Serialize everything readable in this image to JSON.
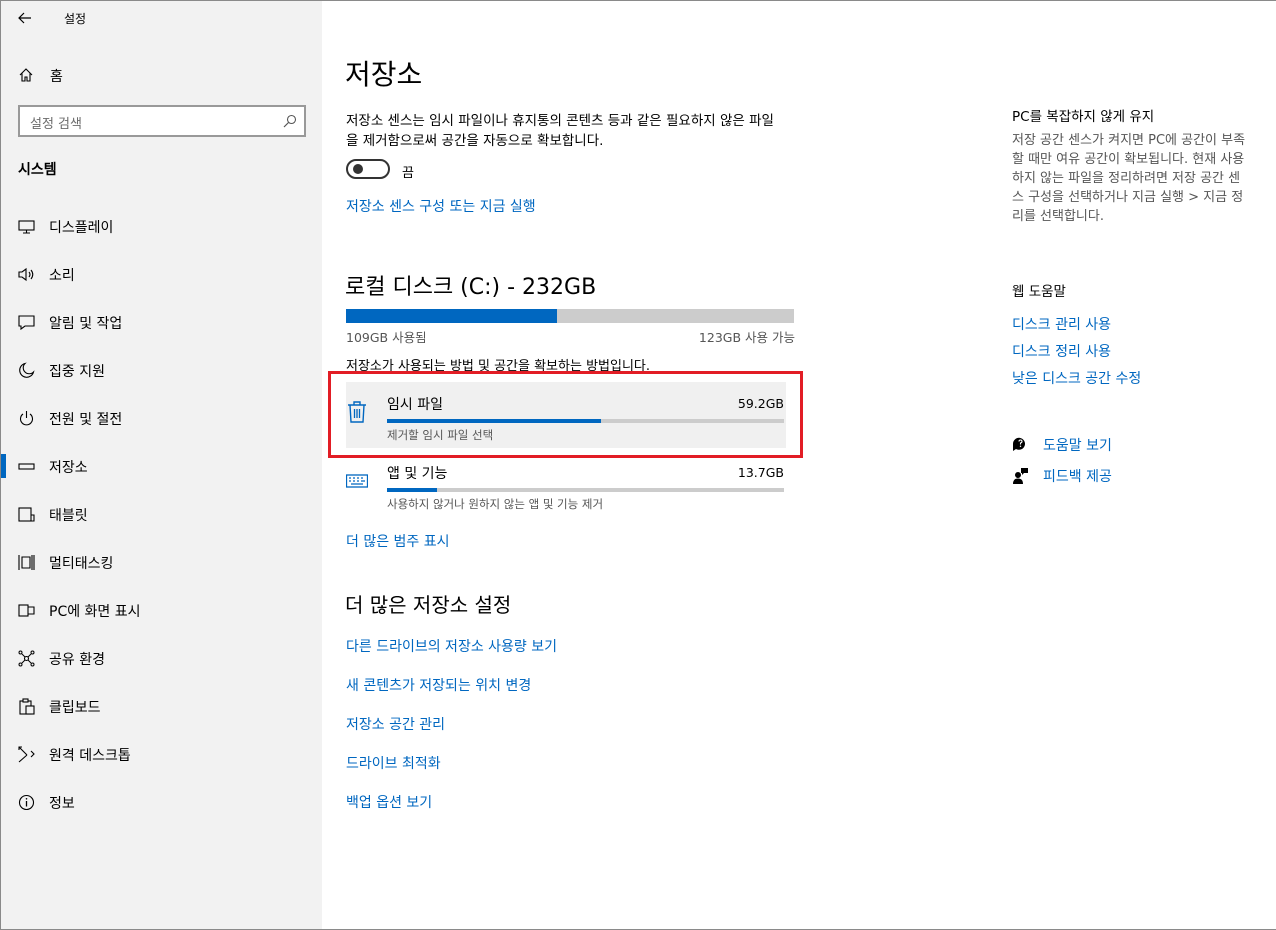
{
  "window": {
    "title": "설정",
    "minimize_glyph": "─",
    "maximize_glyph": "☐",
    "close_glyph": "✕"
  },
  "sidebar": {
    "home_label": "홈",
    "search_placeholder": "설정 검색",
    "section_title": "시스템",
    "items": [
      {
        "label": "디스플레이",
        "icon": "monitor-icon"
      },
      {
        "label": "소리",
        "icon": "speaker-icon"
      },
      {
        "label": "알림 및 작업",
        "icon": "notification-icon"
      },
      {
        "label": "집중 지원",
        "icon": "moon-icon"
      },
      {
        "label": "전원 및 절전",
        "icon": "power-icon"
      },
      {
        "label": "저장소",
        "icon": "storage-icon",
        "active": true
      },
      {
        "label": "태블릿",
        "icon": "tablet-icon"
      },
      {
        "label": "멀티태스킹",
        "icon": "multitasking-icon"
      },
      {
        "label": "PC에 화면 표시",
        "icon": "project-icon"
      },
      {
        "label": "공유 환경",
        "icon": "share-icon"
      },
      {
        "label": "클립보드",
        "icon": "clipboard-icon"
      },
      {
        "label": "원격 데스크톱",
        "icon": "remote-desktop-icon"
      },
      {
        "label": "정보",
        "icon": "info-icon"
      }
    ]
  },
  "main": {
    "title": "저장소",
    "description": "저장소 센스는 임시 파일이나 휴지통의 콘텐츠 등과 같은 필요하지 않은 파일을 제거함으로써 공간을 자동으로 확보합니다.",
    "toggle_state_label": "끔",
    "toggle_on": false,
    "configure_link": "저장소 센스 구성 또는 지금 실행",
    "drive": {
      "title": "로컬 디스크 (C:) - 232GB",
      "used_label": "109GB 사용됨",
      "free_label": "123GB 사용 가능",
      "used_fraction": 0.47
    },
    "hint": "저장소가 사용되는 방법 및 공간을 확보하는 방법입니다.",
    "categories": [
      {
        "name": "임시 파일",
        "size": "59.2GB",
        "sub": "제거할 임시 파일 선택",
        "fraction": 0.54,
        "icon": "trash-icon"
      },
      {
        "name": "앱 및 기능",
        "size": "13.7GB",
        "sub": "사용하지 않거나 원하지 않는 앱 및 기능 제거",
        "fraction": 0.125,
        "icon": "keyboard-icon"
      }
    ],
    "more_categories_link": "더 많은 범주 표시",
    "more_settings_title": "더 많은 저장소 설정",
    "more_links": [
      "다른 드라이브의 저장소 사용량 보기",
      "새 콘텐츠가 저장되는 위치 변경",
      "저장소 공간 관리",
      "드라이브 최적화",
      "백업 옵션 보기"
    ]
  },
  "right": {
    "keep_title": "PC를 복잡하지 않게 유지",
    "keep_text": "저장 공간 센스가 켜지면 PC에 공간이 부족할 때만 여유 공간이 확보됩니다. 현재 사용하지 않는 파일을 정리하려면 저장 공간 센스 구성을 선택하거나 지금 실행 > 지금 정리를 선택합니다.",
    "web_help_title": "웹 도움말",
    "web_links": [
      "디스크 관리 사용",
      "디스크 정리 사용",
      "낮은 디스크 공간 수정"
    ],
    "help_label": "도움말 보기",
    "feedback_label": "피드백 제공"
  },
  "colors": {
    "accent": "#0067c0",
    "highlight": "#e21d25",
    "sidebar_bg": "#f2f2f2"
  }
}
